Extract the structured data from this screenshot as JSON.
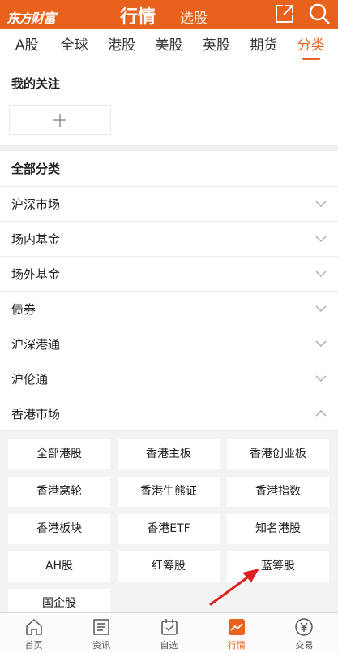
{
  "header": {
    "logo": "东方财富",
    "title": "行情",
    "subtitle": "选股"
  },
  "tabs": [
    {
      "label": "A股"
    },
    {
      "label": "全球"
    },
    {
      "label": "港股"
    },
    {
      "label": "美股"
    },
    {
      "label": "英股"
    },
    {
      "label": "期货"
    },
    {
      "label": "分类",
      "active": true
    }
  ],
  "watchlist": {
    "title": "我的关注"
  },
  "categories": {
    "title": "全部分类",
    "items": [
      {
        "label": "沪深市场"
      },
      {
        "label": "场内基金"
      },
      {
        "label": "场外基金"
      },
      {
        "label": "债券"
      },
      {
        "label": "沪深港通"
      },
      {
        "label": "沪伦通"
      },
      {
        "label": "香港市场",
        "expanded": true
      }
    ]
  },
  "hk_market": {
    "items": [
      "全部港股",
      "香港主板",
      "香港创业板",
      "香港窝轮",
      "香港牛熊证",
      "香港指数",
      "香港板块",
      "香港ETF",
      "知名港股",
      "AH股",
      "红筹股",
      "蓝筹股",
      "国企股"
    ]
  },
  "bottom_nav": [
    {
      "label": "首页",
      "icon": "home-icon"
    },
    {
      "label": "资讯",
      "icon": "news-icon"
    },
    {
      "label": "自选",
      "icon": "watchlist-icon"
    },
    {
      "label": "行情",
      "icon": "market-icon",
      "active": true
    },
    {
      "label": "交易",
      "icon": "trade-icon"
    }
  ],
  "colors": {
    "brand": "#e8611d",
    "annotation_arrow": "#e02020"
  }
}
